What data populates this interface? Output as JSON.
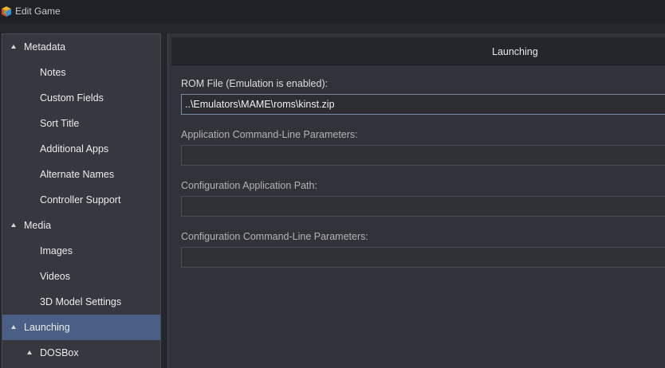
{
  "window": {
    "title": "Edit Game",
    "icon": "app-logo-icon"
  },
  "sidebar": {
    "items": [
      {
        "label": "Metadata",
        "level": 0,
        "expanded": true
      },
      {
        "label": "Notes",
        "level": 1
      },
      {
        "label": "Custom Fields",
        "level": 1
      },
      {
        "label": "Sort Title",
        "level": 1
      },
      {
        "label": "Additional Apps",
        "level": 1
      },
      {
        "label": "Alternate Names",
        "level": 1
      },
      {
        "label": "Controller Support",
        "level": 1
      },
      {
        "label": "Media",
        "level": 0,
        "expanded": true
      },
      {
        "label": "Images",
        "level": 1
      },
      {
        "label": "Videos",
        "level": 1
      },
      {
        "label": "3D Model Settings",
        "level": 1
      },
      {
        "label": "Launching",
        "level": 0,
        "expanded": true,
        "selected": true
      },
      {
        "label": "DOSBox",
        "level": 1,
        "expanded": true
      }
    ]
  },
  "main": {
    "section_title": "Launching",
    "fields": [
      {
        "label": "ROM File (Emulation is enabled):",
        "value": "..\\Emulators\\MAME\\roms\\kinst.zip",
        "enabled": true
      },
      {
        "label": "Application Command-Line Parameters:",
        "value": "",
        "enabled": false
      },
      {
        "label": "Configuration Application Path:",
        "value": "",
        "enabled": false
      },
      {
        "label": "Configuration Command-Line Parameters:",
        "value": "",
        "enabled": false
      }
    ]
  },
  "colors": {
    "selection": "#4a5f86",
    "background": "#26272d",
    "panel": "#32333a"
  }
}
